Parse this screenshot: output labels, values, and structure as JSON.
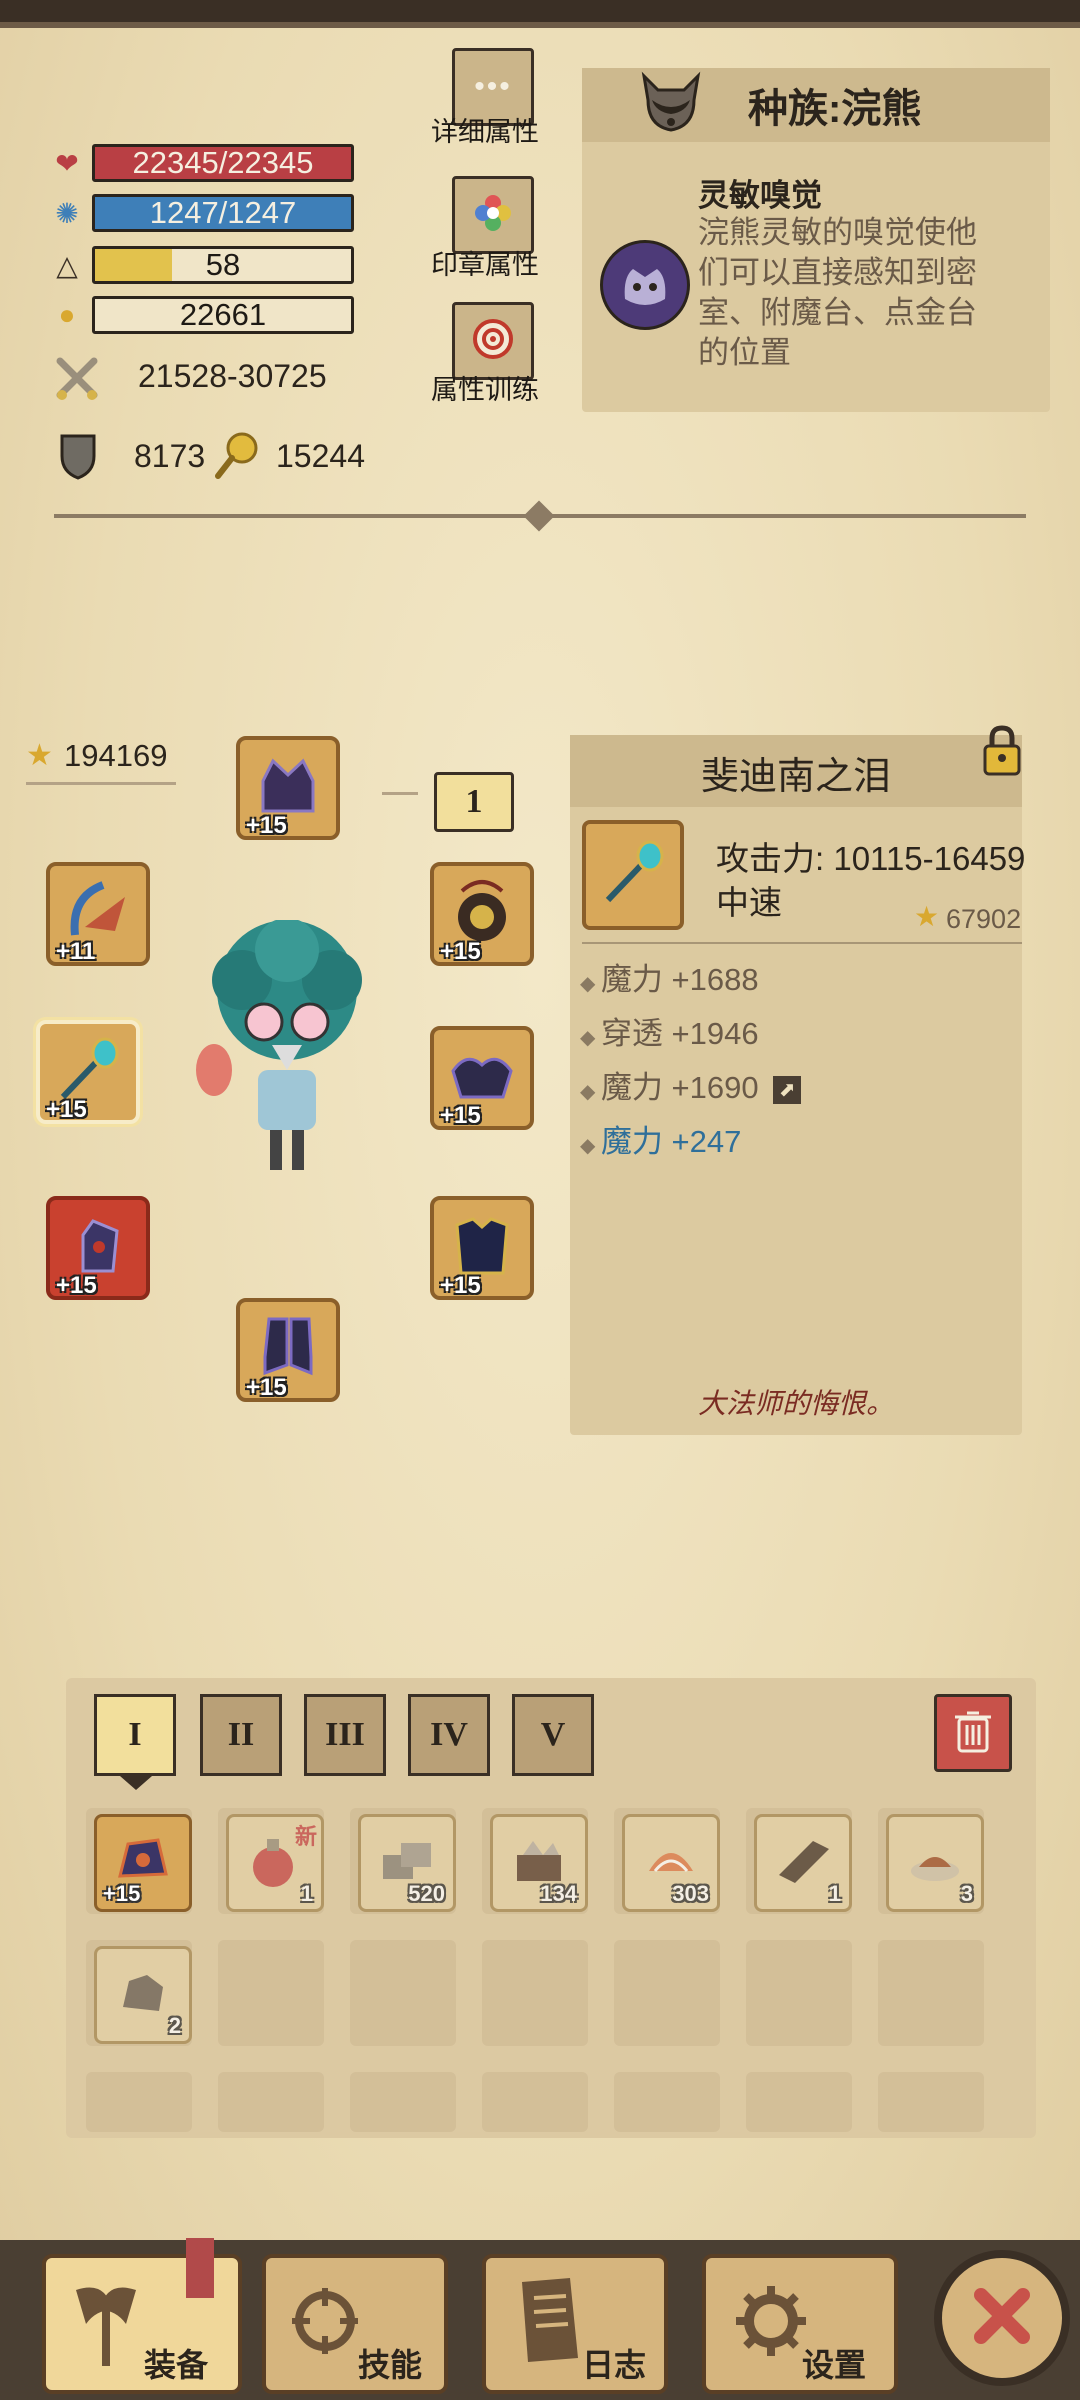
{
  "stats": {
    "hp": "22345/22345",
    "mp": "1247/1247",
    "level": "58",
    "gold": "22661",
    "attack": "21528-30725",
    "defense": "8173",
    "magic_resist": "15244",
    "hp_fill": 1.0,
    "mp_fill": 1.0,
    "xp_fill": 0.3
  },
  "side_buttons": {
    "detail": "详细属性",
    "seal": "印章属性",
    "training": "属性训练"
  },
  "race": {
    "title": "种族:浣熊",
    "trait_name": "灵敏嗅觉",
    "trait_desc_lines": [
      "浣熊灵敏的嗅觉使他",
      "们可以直接感知到密",
      "室、附魔台、点金台",
      "的位置"
    ]
  },
  "equipment": {
    "score": "194169",
    "set_badge": "1",
    "slots": [
      {
        "name": "helmet",
        "level": "+15"
      },
      {
        "name": "bow",
        "level": "+11"
      },
      {
        "name": "amulet",
        "level": "+15"
      },
      {
        "name": "staff",
        "level": "+15"
      },
      {
        "name": "shoulder",
        "level": "+15"
      },
      {
        "name": "glove",
        "level": "+15"
      },
      {
        "name": "armor",
        "level": "+15"
      },
      {
        "name": "boots",
        "level": "+15"
      }
    ]
  },
  "item_detail": {
    "name": "斐迪南之泪",
    "attack": "攻击力: 10115-16459",
    "speed": "中速",
    "score": "67902",
    "attrs": [
      {
        "text": "魔力 +1688",
        "color": "#6a5a48"
      },
      {
        "text": "穿透 +1946",
        "color": "#6a5a48"
      },
      {
        "text": "魔力 +1690",
        "color": "#6a5a48"
      },
      {
        "text": "魔力 +247",
        "color": "#2f6f9a"
      }
    ],
    "flavor": "大法师的悔恨。"
  },
  "inventory": {
    "tabs": [
      "I",
      "II",
      "III",
      "IV",
      "V"
    ],
    "items": [
      {
        "name": "gear-item",
        "count": "+15"
      },
      {
        "name": "potion",
        "count": "1",
        "badge": "新"
      },
      {
        "name": "stone",
        "count": "520"
      },
      {
        "name": "chest-ore",
        "count": "134"
      },
      {
        "name": "shell",
        "count": "303"
      },
      {
        "name": "plank",
        "count": "1"
      },
      {
        "name": "fish-plate",
        "count": "3"
      },
      {
        "name": "rock",
        "count": "2"
      }
    ]
  },
  "nav": {
    "equip": "装备",
    "skills": "技能",
    "log": "日志",
    "settings": "设置"
  }
}
